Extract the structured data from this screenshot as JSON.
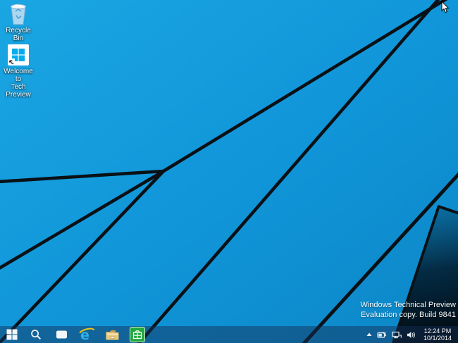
{
  "desktop": {
    "icons": [
      {
        "id": "recycle-bin",
        "label": "Recycle Bin"
      },
      {
        "id": "welcome-tech-preview",
        "label_line1": "Welcome to",
        "label_line2": "Tech Preview"
      }
    ],
    "watermark": {
      "line1": "Windows Technical Preview",
      "line2": "Evaluation copy. Build 9841"
    }
  },
  "taskbar": {
    "buttons": [
      {
        "name": "start",
        "icon": "windows-logo-icon"
      },
      {
        "name": "search",
        "icon": "search-icon"
      },
      {
        "name": "task-view",
        "icon": "task-view-icon"
      },
      {
        "name": "internet-explorer",
        "icon": "ie-icon"
      },
      {
        "name": "file-explorer",
        "icon": "folder-icon"
      },
      {
        "name": "store",
        "icon": "store-icon"
      }
    ],
    "tray": {
      "icons": [
        "chevron-up-icon",
        "battery-icon",
        "network-icon",
        "volume-icon"
      ],
      "clock_time": "12:24 PM",
      "clock_date": "10/1/2014"
    }
  },
  "colors": {
    "wallpaper_blue": "#1296db",
    "beam_dark": "#0a1116",
    "taskbar_tint": "rgba(20,48,88,0.48)",
    "windows_flag_blue": "#00adef",
    "store_green": "#21a83e",
    "ie_blue": "#2fb0e8"
  }
}
